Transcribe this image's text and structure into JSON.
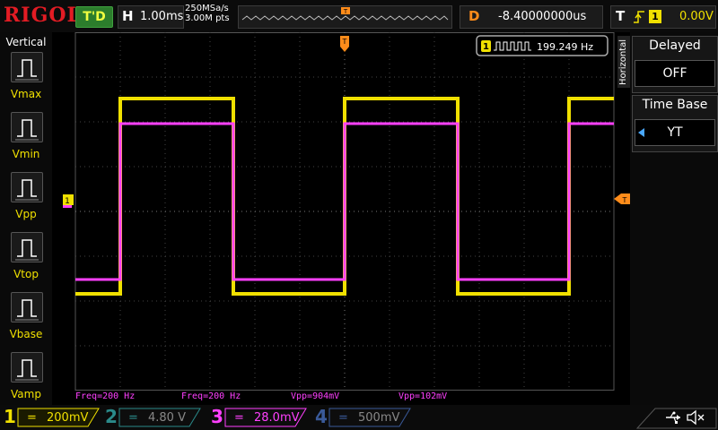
{
  "brand": "RIGOL",
  "run_state": "T'D",
  "timebase": {
    "key": "H",
    "value": "1.00ms"
  },
  "sample": {
    "rate": "250MSa/s",
    "points": "3.00M pts"
  },
  "delay": {
    "key": "D",
    "value": "-8.40000000us"
  },
  "trigger": {
    "key": "T",
    "source": "1",
    "level": "0.00V",
    "edge_icon": "rising-edge-icon"
  },
  "left_menu": {
    "title": "Vertical",
    "items": [
      {
        "label": "Vmax",
        "icon": "vmax-icon"
      },
      {
        "label": "Vmin",
        "icon": "vmin-icon"
      },
      {
        "label": "Vpp",
        "icon": "vpp-icon"
      },
      {
        "label": "Vtop",
        "icon": "vtop-icon"
      },
      {
        "label": "Vbase",
        "icon": "vbase-icon"
      },
      {
        "label": "Vamp",
        "icon": "vamp-icon"
      }
    ]
  },
  "right_menu": {
    "tab": "Horizontal",
    "delayed": {
      "title": "Delayed",
      "value": "OFF"
    },
    "time_base": {
      "title": "Time Base",
      "value": "YT"
    }
  },
  "freq_counter": {
    "channel": "1",
    "value": "199.249 Hz"
  },
  "markers": {
    "ch1": "1",
    "trigger_pos": "T",
    "trigger_level": "T"
  },
  "measurements": {
    "freq1": "Freq=200 Hz",
    "freq3": "Freq=200 Hz",
    "vpp1": "Vpp=904mV",
    "vpp3": "Vpp=102mV"
  },
  "channels": [
    {
      "n": "1",
      "coupling": "=",
      "scale": "200mV",
      "color": "#f0e000"
    },
    {
      "n": "2",
      "coupling": "=",
      "scale": "4.80 V",
      "color": "#2a8a8a"
    },
    {
      "n": "3",
      "coupling": "=",
      "scale": "28.0mV",
      "color": "#ff40ff"
    },
    {
      "n": "4",
      "coupling": "=",
      "scale": "500mV",
      "color": "#3a5a9a"
    }
  ],
  "colors": {
    "ch1": "#f0e000",
    "ch3": "#ff40ff",
    "trigger": "#ff8c1a",
    "brand": "#e31c24"
  }
}
